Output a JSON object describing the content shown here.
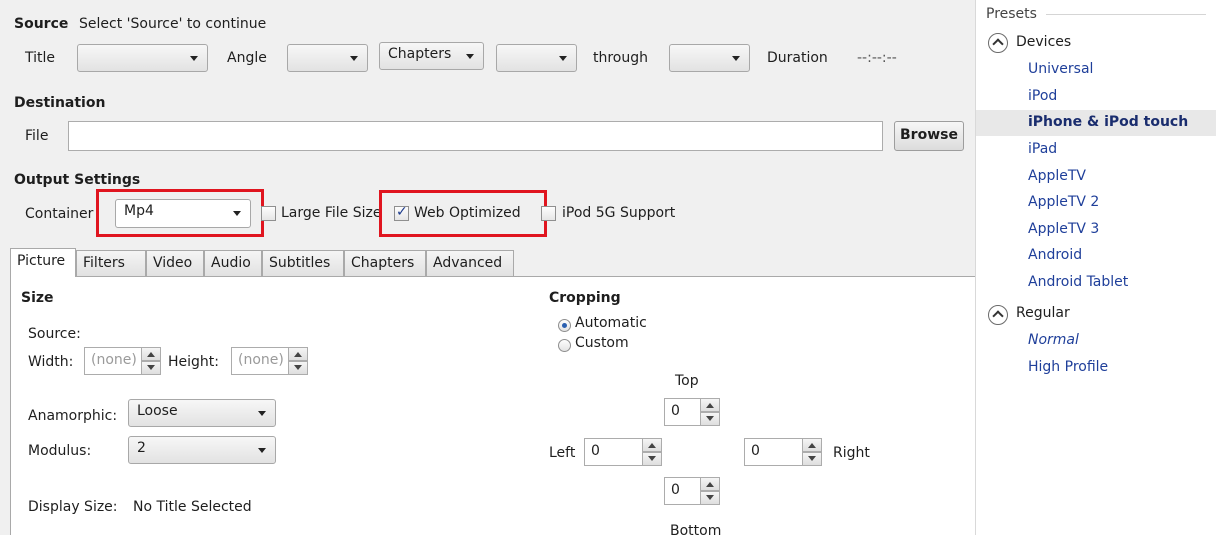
{
  "source": {
    "label": "Source",
    "hint": "Select 'Source' to continue",
    "title_label": "Title",
    "angle_label": "Angle",
    "chapters_mode": "Chapters",
    "through_label": "through",
    "duration_label": "Duration",
    "duration_value": "--:--:--"
  },
  "destination": {
    "label": "Destination",
    "file_label": "File",
    "file_value": "",
    "browse_label": "Browse"
  },
  "output": {
    "label": "Output Settings",
    "container_label": "Container",
    "container_value": "Mp4",
    "large_file_label": "Large File Size",
    "large_file_checked": false,
    "web_optimized_label": "Web Optimized",
    "web_optimized_checked": true,
    "ipod_label": "iPod 5G Support",
    "ipod_checked": false
  },
  "tabs": [
    "Picture",
    "Filters",
    "Video",
    "Audio",
    "Subtitles",
    "Chapters",
    "Advanced"
  ],
  "active_tab": "Picture",
  "picture": {
    "size_label": "Size",
    "source_label": "Source:",
    "width_label": "Width:",
    "width_value": "(none)",
    "height_label": "Height:",
    "height_value": "(none)",
    "anamorphic_label": "Anamorphic:",
    "anamorphic_value": "Loose",
    "modulus_label": "Modulus:",
    "modulus_value": "2",
    "display_size_label": "Display Size:",
    "display_size_value": "No Title Selected",
    "cropping_label": "Cropping",
    "automatic_label": "Automatic",
    "custom_label": "Custom",
    "crop_mode": "Automatic",
    "top_label": "Top",
    "top_value": "0",
    "left_label": "Left",
    "left_value": "0",
    "right_label": "Right",
    "right_value": "0",
    "bottom_label": "Bottom",
    "bottom_value": "0"
  },
  "presets": {
    "header": "Presets",
    "groups": [
      {
        "name": "Devices",
        "items": [
          "Universal",
          "iPod",
          "iPhone & iPod touch",
          "iPad",
          "AppleTV",
          "AppleTV 2",
          "AppleTV 3",
          "Android",
          "Android Tablet"
        ]
      },
      {
        "name": "Regular",
        "items": [
          "Normal",
          "High Profile"
        ]
      }
    ],
    "selected": "iPhone & iPod touch",
    "default_italic": "Normal"
  },
  "colors": {
    "highlight_box": "#e0151f",
    "preset_link": "#1f3f9a"
  }
}
